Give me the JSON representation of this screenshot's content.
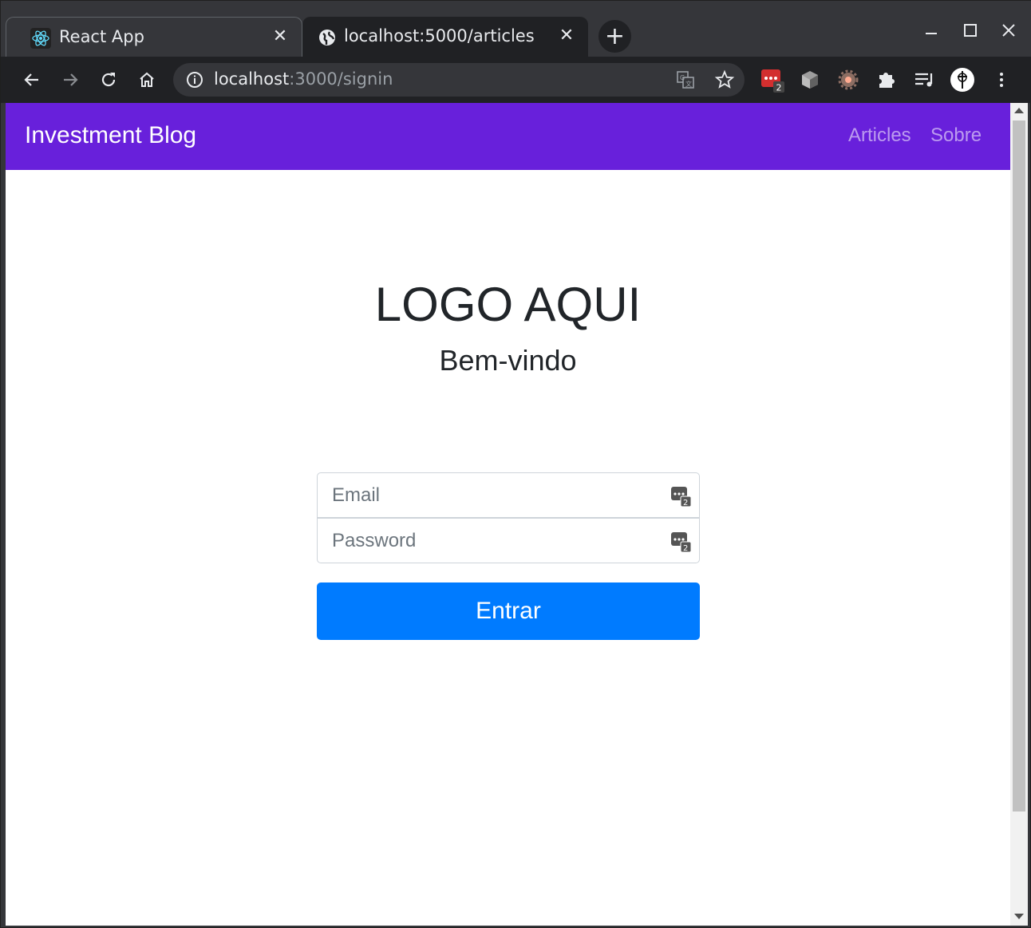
{
  "browser": {
    "tabs": [
      {
        "title": "React App",
        "favicon": "react-icon",
        "active": false
      },
      {
        "title": "localhost:5000/articles",
        "favicon": "globe-icon",
        "active": true
      }
    ],
    "new_tab_label": "+",
    "address": {
      "host": "localhost",
      "rest": ":3000/signin"
    },
    "extension_badge": "2"
  },
  "navbar": {
    "brand": "Investment Blog",
    "links": [
      "Articles",
      "Sobre"
    ],
    "color": "#6820db"
  },
  "main": {
    "logo_text": "LOGO AQUI",
    "welcome": "Bem-vindo"
  },
  "form": {
    "email_placeholder": "Email",
    "password_placeholder": "Password",
    "submit_label": "Entrar",
    "submit_color": "#007bff",
    "field_icon_badge": "2"
  }
}
